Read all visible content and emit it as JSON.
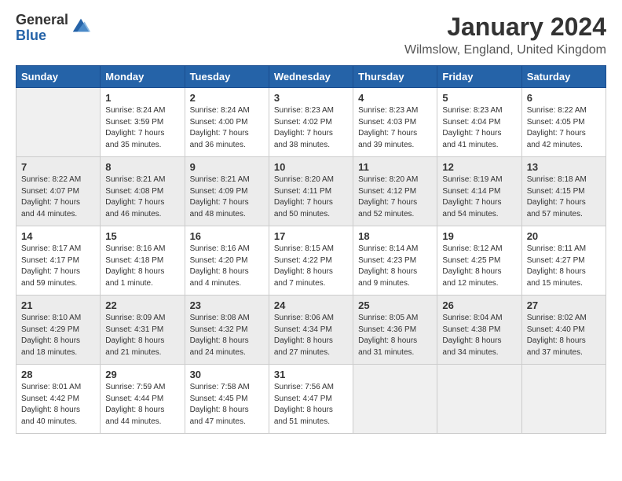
{
  "logo": {
    "general": "General",
    "blue": "Blue"
  },
  "title": "January 2024",
  "location": "Wilmslow, England, United Kingdom",
  "days_of_week": [
    "Sunday",
    "Monday",
    "Tuesday",
    "Wednesday",
    "Thursday",
    "Friday",
    "Saturday"
  ],
  "weeks": [
    [
      {
        "day": "",
        "sunrise": "",
        "sunset": "",
        "daylight": ""
      },
      {
        "day": "1",
        "sunrise": "Sunrise: 8:24 AM",
        "sunset": "Sunset: 3:59 PM",
        "daylight": "Daylight: 7 hours and 35 minutes."
      },
      {
        "day": "2",
        "sunrise": "Sunrise: 8:24 AM",
        "sunset": "Sunset: 4:00 PM",
        "daylight": "Daylight: 7 hours and 36 minutes."
      },
      {
        "day": "3",
        "sunrise": "Sunrise: 8:23 AM",
        "sunset": "Sunset: 4:02 PM",
        "daylight": "Daylight: 7 hours and 38 minutes."
      },
      {
        "day": "4",
        "sunrise": "Sunrise: 8:23 AM",
        "sunset": "Sunset: 4:03 PM",
        "daylight": "Daylight: 7 hours and 39 minutes."
      },
      {
        "day": "5",
        "sunrise": "Sunrise: 8:23 AM",
        "sunset": "Sunset: 4:04 PM",
        "daylight": "Daylight: 7 hours and 41 minutes."
      },
      {
        "day": "6",
        "sunrise": "Sunrise: 8:22 AM",
        "sunset": "Sunset: 4:05 PM",
        "daylight": "Daylight: 7 hours and 42 minutes."
      }
    ],
    [
      {
        "day": "7",
        "sunrise": "Sunrise: 8:22 AM",
        "sunset": "Sunset: 4:07 PM",
        "daylight": "Daylight: 7 hours and 44 minutes."
      },
      {
        "day": "8",
        "sunrise": "Sunrise: 8:21 AM",
        "sunset": "Sunset: 4:08 PM",
        "daylight": "Daylight: 7 hours and 46 minutes."
      },
      {
        "day": "9",
        "sunrise": "Sunrise: 8:21 AM",
        "sunset": "Sunset: 4:09 PM",
        "daylight": "Daylight: 7 hours and 48 minutes."
      },
      {
        "day": "10",
        "sunrise": "Sunrise: 8:20 AM",
        "sunset": "Sunset: 4:11 PM",
        "daylight": "Daylight: 7 hours and 50 minutes."
      },
      {
        "day": "11",
        "sunrise": "Sunrise: 8:20 AM",
        "sunset": "Sunset: 4:12 PM",
        "daylight": "Daylight: 7 hours and 52 minutes."
      },
      {
        "day": "12",
        "sunrise": "Sunrise: 8:19 AM",
        "sunset": "Sunset: 4:14 PM",
        "daylight": "Daylight: 7 hours and 54 minutes."
      },
      {
        "day": "13",
        "sunrise": "Sunrise: 8:18 AM",
        "sunset": "Sunset: 4:15 PM",
        "daylight": "Daylight: 7 hours and 57 minutes."
      }
    ],
    [
      {
        "day": "14",
        "sunrise": "Sunrise: 8:17 AM",
        "sunset": "Sunset: 4:17 PM",
        "daylight": "Daylight: 7 hours and 59 minutes."
      },
      {
        "day": "15",
        "sunrise": "Sunrise: 8:16 AM",
        "sunset": "Sunset: 4:18 PM",
        "daylight": "Daylight: 8 hours and 1 minute."
      },
      {
        "day": "16",
        "sunrise": "Sunrise: 8:16 AM",
        "sunset": "Sunset: 4:20 PM",
        "daylight": "Daylight: 8 hours and 4 minutes."
      },
      {
        "day": "17",
        "sunrise": "Sunrise: 8:15 AM",
        "sunset": "Sunset: 4:22 PM",
        "daylight": "Daylight: 8 hours and 7 minutes."
      },
      {
        "day": "18",
        "sunrise": "Sunrise: 8:14 AM",
        "sunset": "Sunset: 4:23 PM",
        "daylight": "Daylight: 8 hours and 9 minutes."
      },
      {
        "day": "19",
        "sunrise": "Sunrise: 8:12 AM",
        "sunset": "Sunset: 4:25 PM",
        "daylight": "Daylight: 8 hours and 12 minutes."
      },
      {
        "day": "20",
        "sunrise": "Sunrise: 8:11 AM",
        "sunset": "Sunset: 4:27 PM",
        "daylight": "Daylight: 8 hours and 15 minutes."
      }
    ],
    [
      {
        "day": "21",
        "sunrise": "Sunrise: 8:10 AM",
        "sunset": "Sunset: 4:29 PM",
        "daylight": "Daylight: 8 hours and 18 minutes."
      },
      {
        "day": "22",
        "sunrise": "Sunrise: 8:09 AM",
        "sunset": "Sunset: 4:31 PM",
        "daylight": "Daylight: 8 hours and 21 minutes."
      },
      {
        "day": "23",
        "sunrise": "Sunrise: 8:08 AM",
        "sunset": "Sunset: 4:32 PM",
        "daylight": "Daylight: 8 hours and 24 minutes."
      },
      {
        "day": "24",
        "sunrise": "Sunrise: 8:06 AM",
        "sunset": "Sunset: 4:34 PM",
        "daylight": "Daylight: 8 hours and 27 minutes."
      },
      {
        "day": "25",
        "sunrise": "Sunrise: 8:05 AM",
        "sunset": "Sunset: 4:36 PM",
        "daylight": "Daylight: 8 hours and 31 minutes."
      },
      {
        "day": "26",
        "sunrise": "Sunrise: 8:04 AM",
        "sunset": "Sunset: 4:38 PM",
        "daylight": "Daylight: 8 hours and 34 minutes."
      },
      {
        "day": "27",
        "sunrise": "Sunrise: 8:02 AM",
        "sunset": "Sunset: 4:40 PM",
        "daylight": "Daylight: 8 hours and 37 minutes."
      }
    ],
    [
      {
        "day": "28",
        "sunrise": "Sunrise: 8:01 AM",
        "sunset": "Sunset: 4:42 PM",
        "daylight": "Daylight: 8 hours and 40 minutes."
      },
      {
        "day": "29",
        "sunrise": "Sunrise: 7:59 AM",
        "sunset": "Sunset: 4:44 PM",
        "daylight": "Daylight: 8 hours and 44 minutes."
      },
      {
        "day": "30",
        "sunrise": "Sunrise: 7:58 AM",
        "sunset": "Sunset: 4:45 PM",
        "daylight": "Daylight: 8 hours and 47 minutes."
      },
      {
        "day": "31",
        "sunrise": "Sunrise: 7:56 AM",
        "sunset": "Sunset: 4:47 PM",
        "daylight": "Daylight: 8 hours and 51 minutes."
      },
      {
        "day": "",
        "sunrise": "",
        "sunset": "",
        "daylight": ""
      },
      {
        "day": "",
        "sunrise": "",
        "sunset": "",
        "daylight": ""
      },
      {
        "day": "",
        "sunrise": "",
        "sunset": "",
        "daylight": ""
      }
    ]
  ]
}
